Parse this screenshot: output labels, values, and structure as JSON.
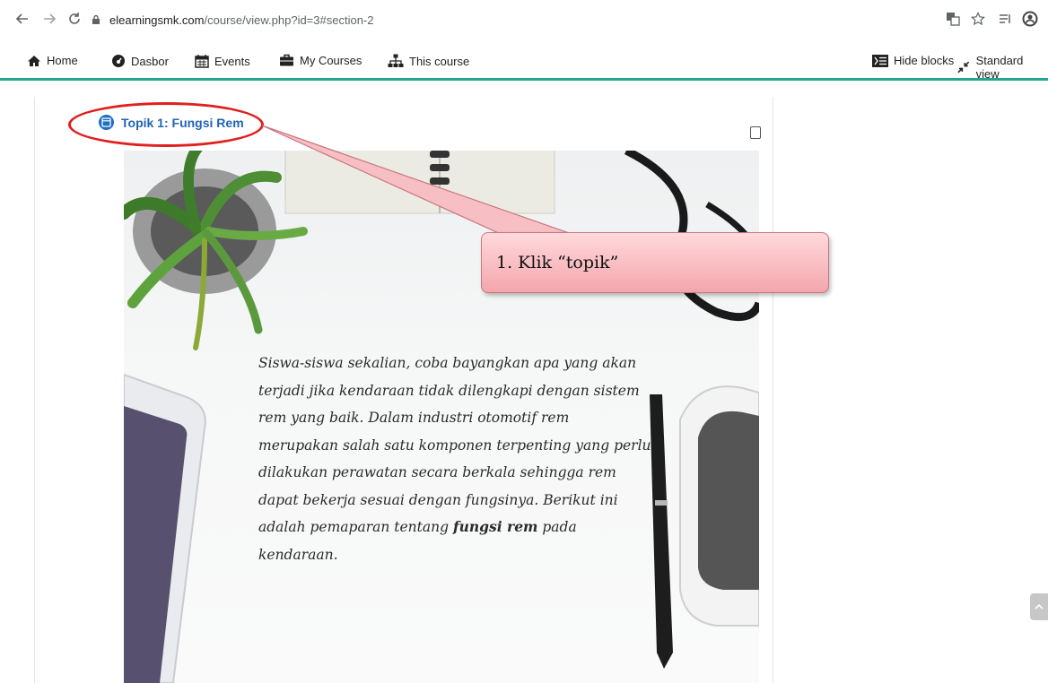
{
  "browser": {
    "url_domain": "elearningsmk.com",
    "url_path": "/course/view.php?id=3#section-2",
    "back_icon": "arrow-left-icon",
    "forward_icon": "arrow-right-icon",
    "reload_icon": "reload-icon"
  },
  "navbar": {
    "items": [
      {
        "label": "Home",
        "icon": "home-icon"
      },
      {
        "label": "Dasbor",
        "icon": "dashboard-icon"
      },
      {
        "label": "Events",
        "icon": "calendar-icon"
      },
      {
        "label": "My Courses",
        "icon": "briefcase-icon"
      },
      {
        "label": "This course",
        "icon": "sitemap-icon"
      }
    ],
    "hide_blocks": "Hide blocks",
    "standard_view": "Standard view"
  },
  "topic": {
    "title": "Topik 1: Fungsi Rem"
  },
  "banner": {
    "line1": "Siswa-siswa sekalian, coba bayangkan apa yang akan",
    "line2": "terjadi jika kendaraan tidak dilengkapi dengan sistem",
    "line3": "rem yang baik. Dalam industri otomotif rem",
    "line4": "merupakan salah satu komponen terpenting yang perlu",
    "line5": "dilakukan perawatan secara berkala sehingga rem",
    "line6": "dapat bekerja sesuai dengan fungsinya. Berikut ini",
    "line7_before": "adalah pemaparan tentang ",
    "line7_bold": "fungsi rem",
    "line7_after": " pada kendaraan."
  },
  "callout": {
    "text": "1. Klik “topik”"
  },
  "colors": {
    "accent": "#1fa88f",
    "link": "#1f64b5",
    "highlight": "#e01f1f"
  }
}
